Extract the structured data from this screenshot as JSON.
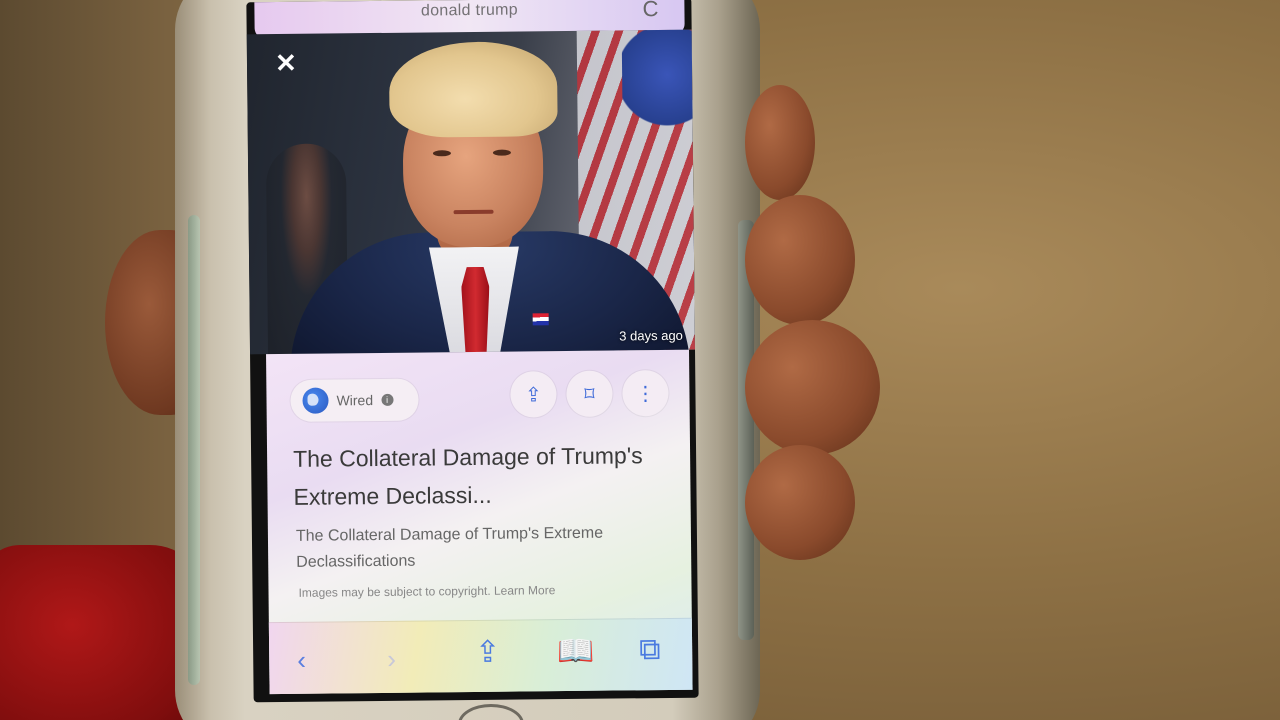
{
  "browser": {
    "url_text": "donald trump",
    "reload_glyph": "C"
  },
  "image_viewer": {
    "close_glyph": "✕",
    "timestamp": "3 days ago"
  },
  "result_card": {
    "source": "Wired",
    "info_glyph": "i",
    "share_glyph": "⇪",
    "bookmark_glyph": "⌑",
    "more_glyph": "⋮",
    "title": "The Collateral Damage of Trump's Extreme Declassi...",
    "subtitle": "The Collateral Damage of Trump's Extreme Declassifications",
    "copyright_note": "Images may be subject to copyright.",
    "learn_more": "Learn More"
  },
  "safari_toolbar": {
    "back_glyph": "‹",
    "forward_glyph": "›",
    "share_glyph": "⇪",
    "bookmarks_glyph": "📖",
    "tabs_glyph": "⧉"
  }
}
